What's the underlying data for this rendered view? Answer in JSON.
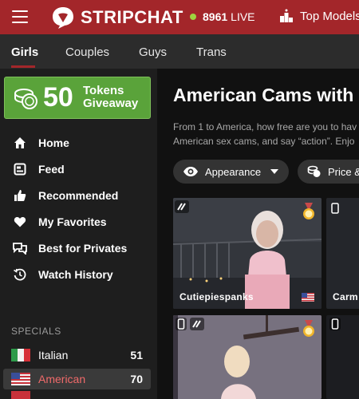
{
  "header": {
    "brand": "STRIPCHAT",
    "live_count": "8961",
    "live_label": "LIVE",
    "top_models": "Top Models"
  },
  "tabs": [
    {
      "label": "Girls",
      "active": true
    },
    {
      "label": "Couples"
    },
    {
      "label": "Guys"
    },
    {
      "label": "Trans"
    }
  ],
  "giveaway": {
    "number": "50",
    "line1": "Tokens",
    "line2": "Giveaway"
  },
  "nav": [
    {
      "label": "Home",
      "icon": "home-icon"
    },
    {
      "label": "Feed",
      "icon": "feed-icon"
    },
    {
      "label": "Recommended",
      "icon": "thumbs-up-icon"
    },
    {
      "label": "My Favorites",
      "icon": "heart-icon"
    },
    {
      "label": "Best for Privates",
      "icon": "chat-bubbles-icon"
    },
    {
      "label": "Watch History",
      "icon": "history-icon"
    }
  ],
  "specials": {
    "heading": "SPECIALS",
    "items": [
      {
        "label": "Italian",
        "count": "51",
        "flag": "italy-flag-icon"
      },
      {
        "label": "American",
        "count": "70",
        "flag": "usa-flag-icon",
        "active": true
      }
    ]
  },
  "main": {
    "title": "American Cams with G",
    "desc_line1": "From 1 to America, how free are you to hav",
    "desc_line2": "American sex cams, and say “action”. Enjo",
    "filters": [
      {
        "label": "Appearance",
        "icon": "eye-icon"
      },
      {
        "label": "Price &",
        "icon": "coins-icon"
      }
    ],
    "cards": [
      {
        "name": "Cutiepiespanks"
      },
      {
        "name": "Carm"
      }
    ]
  },
  "colors": {
    "brand": "#a3262a",
    "giveaway": "#5aa33a",
    "live": "#9fd33f"
  }
}
